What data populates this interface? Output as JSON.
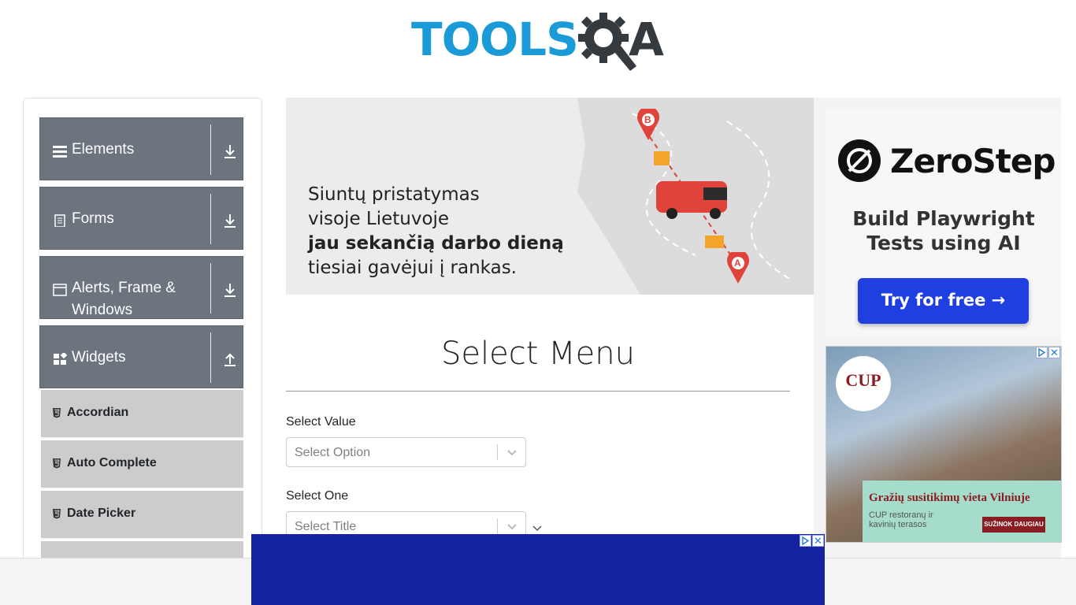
{
  "logo": {
    "part1": "TOOLS",
    "part2": "A",
    "name": "toolsqa-logo"
  },
  "sidebar": {
    "groups": [
      {
        "label": "Elements",
        "icon": "hamburger-icon",
        "arrow": "download-arrow-icon"
      },
      {
        "label": "Forms",
        "icon": "document-icon",
        "arrow": "download-arrow-icon"
      },
      {
        "label": "Alerts, Frame & Windows",
        "icon": "window-icon",
        "arrow": "download-arrow-icon"
      },
      {
        "label": "Widgets",
        "icon": "widgets-icon",
        "arrow": "upload-arrow-icon"
      }
    ],
    "items": [
      {
        "label": "Accordian",
        "icon": "html5-icon"
      },
      {
        "label": "Auto Complete",
        "icon": "html5-icon"
      },
      {
        "label": "Date Picker",
        "icon": "html5-icon"
      }
    ]
  },
  "banner": {
    "line1": "Siuntų pristatymas",
    "line2": "visoje Lietuvoje",
    "line3": "jau sekančią darbo dieną",
    "line4": "tiesiai gavėjui į rankas.",
    "pin_b": "B",
    "pin_a": "A"
  },
  "main": {
    "title": "Select Menu",
    "select_value": {
      "label": "Select Value",
      "placeholder": "Select Option"
    },
    "select_one": {
      "label": "Select One",
      "placeholder": "Select Title"
    }
  },
  "ad_zerostep": {
    "brand": "ZeroStep",
    "tagline1": "Build Playwright",
    "tagline2": "Tests using AI",
    "button": "Try for free →"
  },
  "ad_cup": {
    "badge": "CUP",
    "headline": "Gražių susitikimų vieta Vilniuje",
    "sub": "CUP restoranų ir kavinių terasos",
    "button": "SUŽINOK DAUGIAU"
  },
  "colors": {
    "accent_blue": "#1a9ad6",
    "sidebar_group": "#6c757d",
    "sidebar_item": "#cccccc",
    "zerostep_button": "#1f3fe0",
    "bottom_ad": "#1623a0"
  }
}
